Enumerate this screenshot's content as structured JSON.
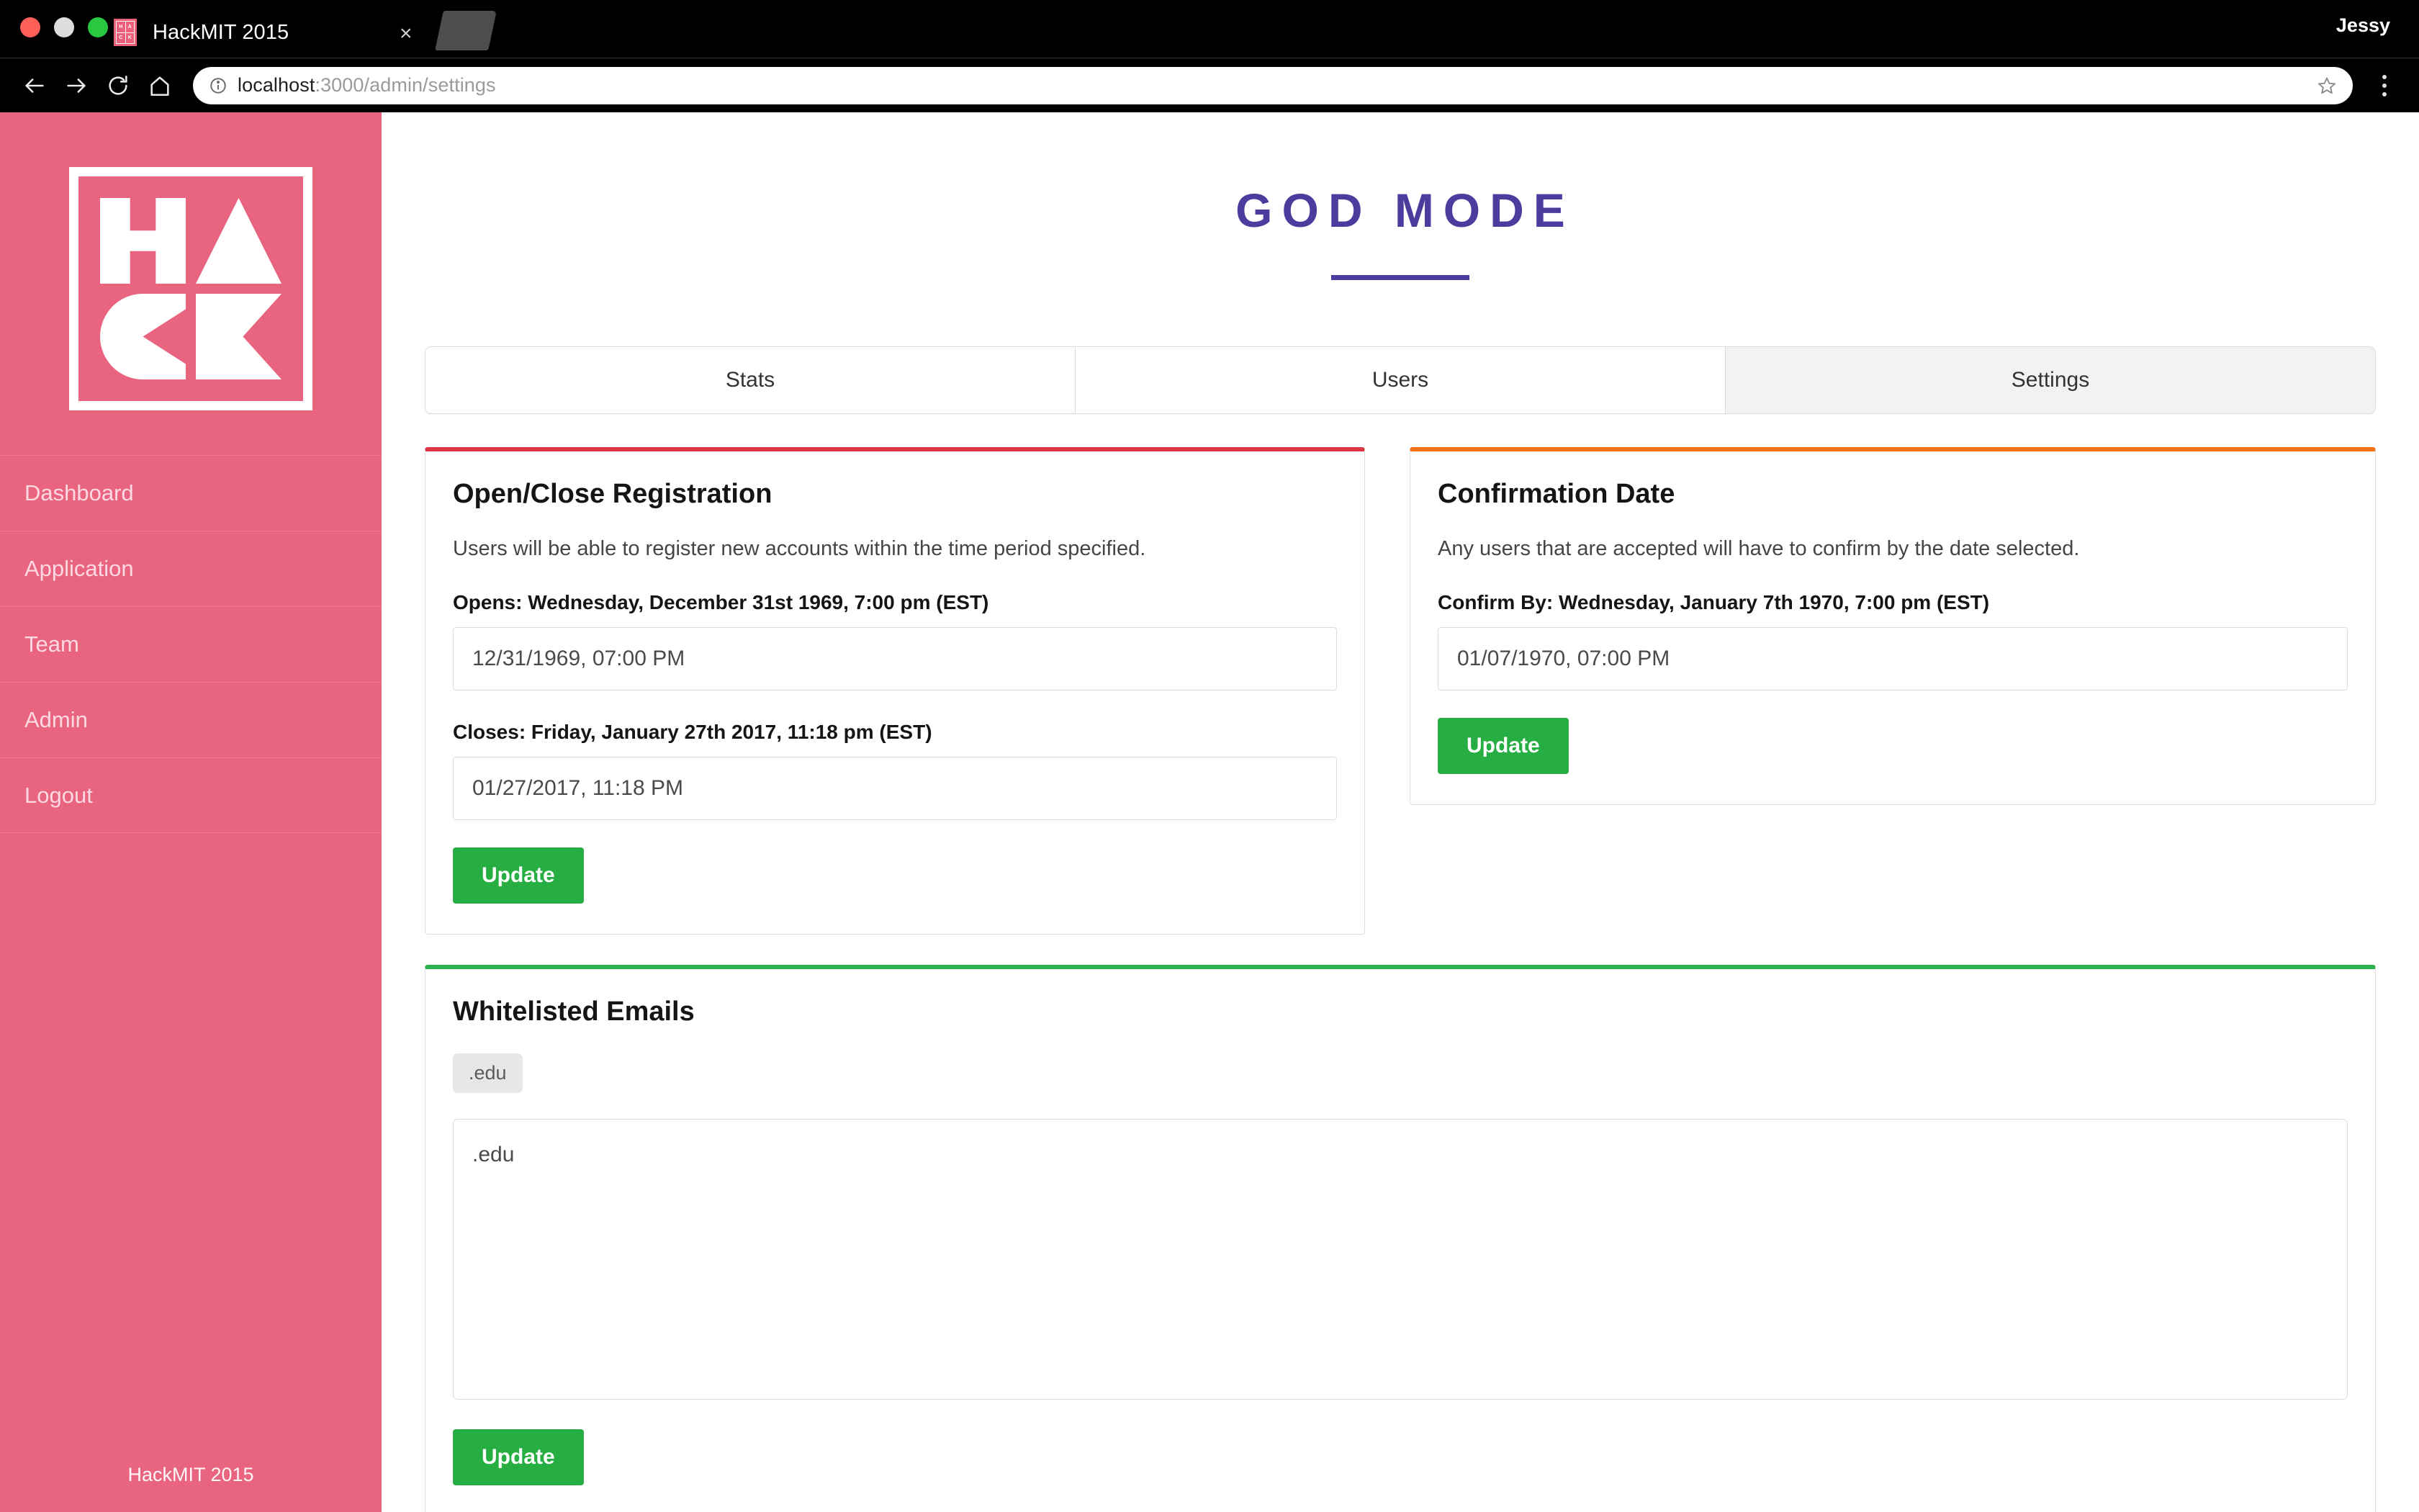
{
  "browser": {
    "tab_title": "HackMIT 2015",
    "favicon_letters": [
      "H",
      "A",
      "C",
      "K"
    ],
    "close_label": "×",
    "profile_name": "Jessy",
    "url_host": "localhost",
    "url_path": ":3000/admin/settings",
    "icons": {
      "back": "back-arrow-icon",
      "forward": "forward-arrow-icon",
      "reload": "reload-icon",
      "home": "home-icon",
      "info": "site-info-icon",
      "bookmark": "star-icon",
      "menu": "kebab-menu-icon"
    }
  },
  "sidebar": {
    "logo_alt": "HACK logo",
    "items": [
      {
        "label": "Dashboard"
      },
      {
        "label": "Application"
      },
      {
        "label": "Team"
      },
      {
        "label": "Admin"
      },
      {
        "label": "Logout"
      }
    ],
    "footer": "HackMIT 2015"
  },
  "main": {
    "page_title": "GOD MODE",
    "tabs": [
      {
        "label": "Stats",
        "active": false
      },
      {
        "label": "Users",
        "active": false
      },
      {
        "label": "Settings",
        "active": true
      }
    ],
    "registration_card": {
      "accent_color": "#dc3545",
      "title": "Open/Close Registration",
      "description": "Users will be able to register new accounts within the time period specified.",
      "opens_label": "Opens: Wednesday, December 31st 1969, 7:00 pm (EST)",
      "opens_value": "12/31/1969, 07:00 PM",
      "closes_label": "Closes: Friday, January 27th 2017, 11:18 pm (EST)",
      "closes_value": "01/27/2017, 11:18 PM",
      "update_label": "Update"
    },
    "confirmation_card": {
      "accent_color": "#f97316",
      "title": "Confirmation Date",
      "description": "Any users that are accepted will have to confirm by the date selected.",
      "confirm_label": "Confirm By: Wednesday, January 7th 1970, 7:00 pm (EST)",
      "confirm_value": "01/07/1970, 07:00 PM",
      "update_label": "Update"
    },
    "whitelist_card": {
      "accent_color": "#2bb24c",
      "title": "Whitelisted Emails",
      "chips": [
        ".edu"
      ],
      "textarea_value": ".edu",
      "update_label": "Update"
    }
  }
}
